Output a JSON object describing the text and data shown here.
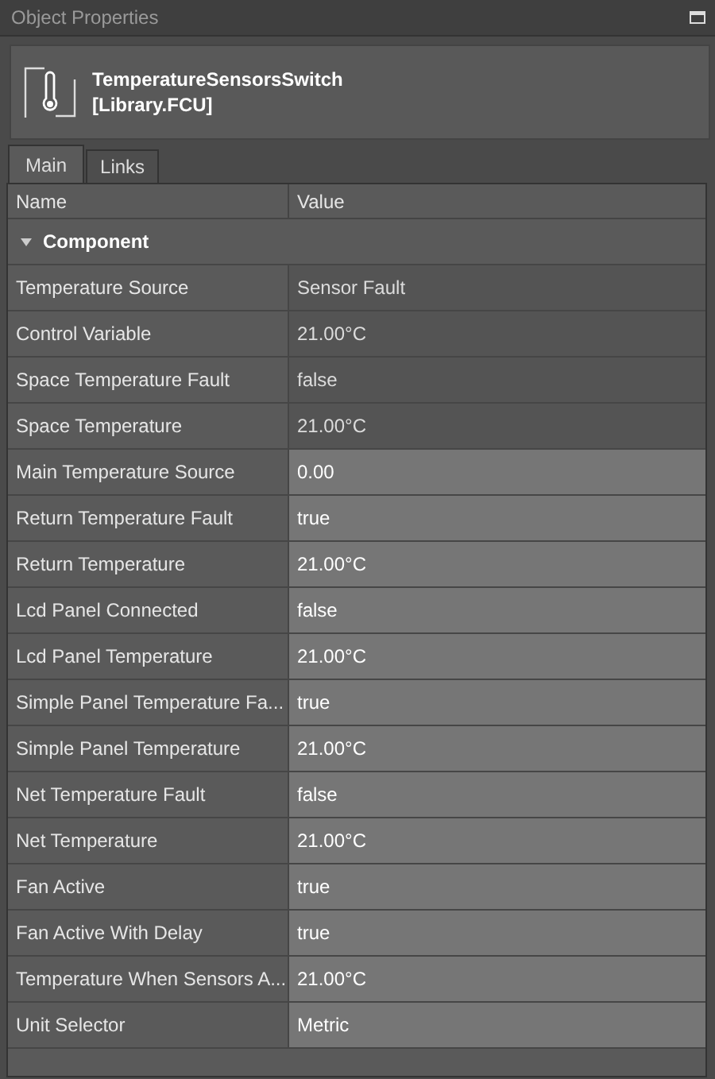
{
  "panel": {
    "title": "Object Properties"
  },
  "object": {
    "name": "TemperatureSensorsSwitch",
    "library": "[Library.FCU]"
  },
  "tabs": [
    {
      "label": "Main",
      "selected": true
    },
    {
      "label": "Links",
      "selected": false
    }
  ],
  "table": {
    "columns": [
      "Name",
      "Value"
    ],
    "group": {
      "label": "Component",
      "expanded": true
    },
    "rows": [
      {
        "name": "Temperature Source",
        "value": "Sensor Fault",
        "editable": false
      },
      {
        "name": "Control Variable",
        "value": "21.00°C",
        "editable": false
      },
      {
        "name": "Space Temperature Fault",
        "value": "false",
        "editable": false
      },
      {
        "name": "Space Temperature",
        "value": "21.00°C",
        "editable": false
      },
      {
        "name": "Main Temperature Source",
        "value": "0.00",
        "editable": true
      },
      {
        "name": "Return Temperature Fault",
        "value": "true",
        "editable": true
      },
      {
        "name": "Return Temperature",
        "value": "21.00°C",
        "editable": true
      },
      {
        "name": "Lcd Panel Connected",
        "value": "false",
        "editable": true
      },
      {
        "name": "Lcd Panel Temperature",
        "value": "21.00°C",
        "editable": true
      },
      {
        "name": "Simple Panel Temperature Fa...",
        "value": "true",
        "editable": true
      },
      {
        "name": "Simple Panel Temperature",
        "value": "21.00°C",
        "editable": true
      },
      {
        "name": "Net Temperature Fault",
        "value": "false",
        "editable": true
      },
      {
        "name": "Net Temperature",
        "value": "21.00°C",
        "editable": true
      },
      {
        "name": "Fan Active",
        "value": "true",
        "editable": true
      },
      {
        "name": "Fan Active With Delay",
        "value": "true",
        "editable": true
      },
      {
        "name": "Temperature When Sensors A...",
        "value": "21.00°C",
        "editable": true
      },
      {
        "name": "Unit Selector",
        "value": "Metric",
        "editable": true
      }
    ]
  }
}
